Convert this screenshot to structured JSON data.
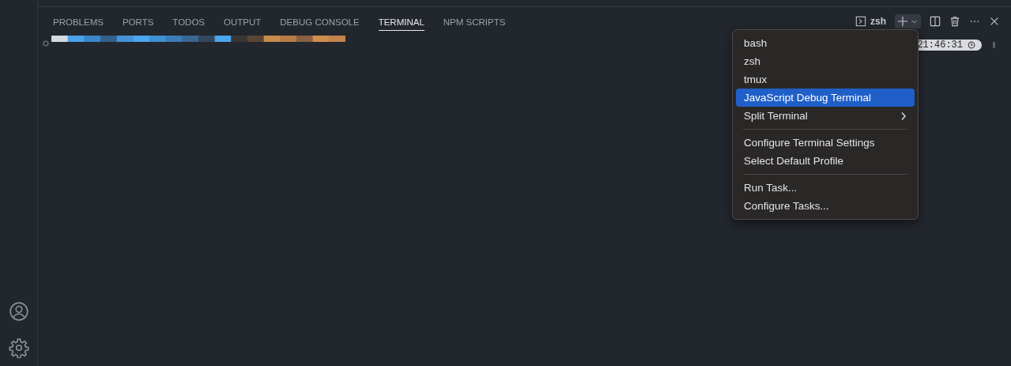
{
  "panel_tabs": [
    {
      "label": "PROBLEMS",
      "selected": false
    },
    {
      "label": "PORTS",
      "selected": false
    },
    {
      "label": "TODOS",
      "selected": false
    },
    {
      "label": "OUTPUT",
      "selected": false
    },
    {
      "label": "DEBUG CONSOLE",
      "selected": false
    },
    {
      "label": "TERMINAL",
      "selected": true
    },
    {
      "label": "NPM SCRIPTS",
      "selected": false
    }
  ],
  "terminal_toolbar": {
    "terminal_name": "zsh"
  },
  "terminal": {
    "time": "21:46:31"
  },
  "dropdown_menu": {
    "groups": [
      [
        {
          "label": "bash",
          "kind": "item",
          "selected": false
        },
        {
          "label": "zsh",
          "kind": "item",
          "selected": false
        },
        {
          "label": "tmux",
          "kind": "item",
          "selected": false
        },
        {
          "label": "JavaScript Debug Terminal",
          "kind": "item",
          "selected": true
        },
        {
          "label": "Split Terminal",
          "kind": "submenu",
          "selected": false
        }
      ],
      [
        {
          "label": "Configure Terminal Settings",
          "kind": "item",
          "selected": false
        },
        {
          "label": "Select Default Profile",
          "kind": "item",
          "selected": false
        }
      ],
      [
        {
          "label": "Run Task...",
          "kind": "item",
          "selected": false
        },
        {
          "label": "Configure Tasks...",
          "kind": "item",
          "selected": false
        }
      ]
    ]
  }
}
